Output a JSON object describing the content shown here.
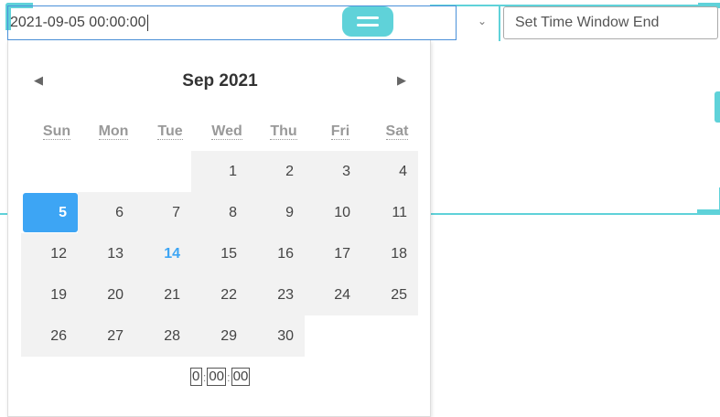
{
  "start_input": {
    "value": "2021-09-05 00:00:00"
  },
  "end_input": {
    "placeholder": "Set Time Window End"
  },
  "dropdown": {
    "icon": "chevron-down-icon"
  },
  "calendar": {
    "month_label": "Sep",
    "year_label": "2021",
    "prev_icon": "triangle-left-icon",
    "next_icon": "triangle-right-icon",
    "weekdays": [
      "Sun",
      "Mon",
      "Tue",
      "Wed",
      "Thu",
      "Fri",
      "Sat"
    ],
    "weeks": [
      [
        "",
        "",
        "",
        "1",
        "2",
        "3",
        "4"
      ],
      [
        "5",
        "6",
        "7",
        "8",
        "9",
        "10",
        "11"
      ],
      [
        "12",
        "13",
        "14",
        "15",
        "16",
        "17",
        "18"
      ],
      [
        "19",
        "20",
        "21",
        "22",
        "23",
        "24",
        "25"
      ],
      [
        "26",
        "27",
        "28",
        "29",
        "30",
        "",
        ""
      ]
    ],
    "selected_day": "5",
    "today_day": "14",
    "time": {
      "hour": "0",
      "minute": "00",
      "second": "00",
      "separator": ":"
    }
  },
  "colors": {
    "accent": "#3da5f4",
    "frame": "#5fd2d9",
    "input_border": "#4a90d9"
  }
}
